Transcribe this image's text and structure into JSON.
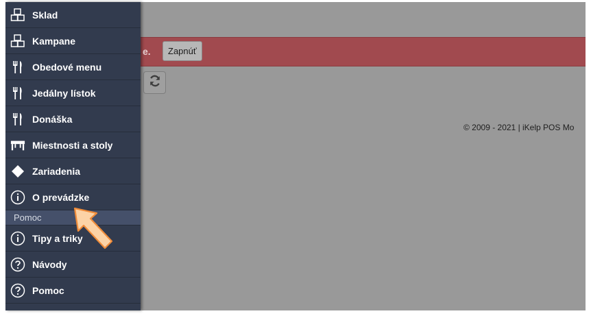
{
  "alert": {
    "text": "e.",
    "button_label": "Zapnúť"
  },
  "footer": {
    "text": "© 2009 - 2021 | iKelp POS Mo"
  },
  "sidebar": {
    "items_top": [
      {
        "label": "Sklad",
        "icon": "boxes-icon"
      },
      {
        "label": "Kampane",
        "icon": "boxes-icon"
      },
      {
        "label": "Obedové menu",
        "icon": "utensils-icon"
      },
      {
        "label": "Jedálny lístok",
        "icon": "utensils-icon"
      },
      {
        "label": "Donáška",
        "icon": "utensils-icon"
      },
      {
        "label": "Miestnosti a stoly",
        "icon": "table-icon"
      },
      {
        "label": "Zariadenia",
        "icon": "diamond-icon"
      },
      {
        "label": "O prevádzke",
        "icon": "info-icon"
      }
    ],
    "section_help": "Pomoc",
    "items_help": [
      {
        "label": "Tipy a triky",
        "icon": "info-icon"
      },
      {
        "label": "Návody",
        "icon": "question-icon"
      },
      {
        "label": "Pomoc",
        "icon": "question-icon"
      }
    ]
  },
  "colors": {
    "sidebar_bg": "#323b4e",
    "alert_bg": "#a14a4f",
    "overlay_bg": "#999999",
    "arrow_fill": "#fcd3a6",
    "arrow_stroke": "#f08c3a"
  }
}
